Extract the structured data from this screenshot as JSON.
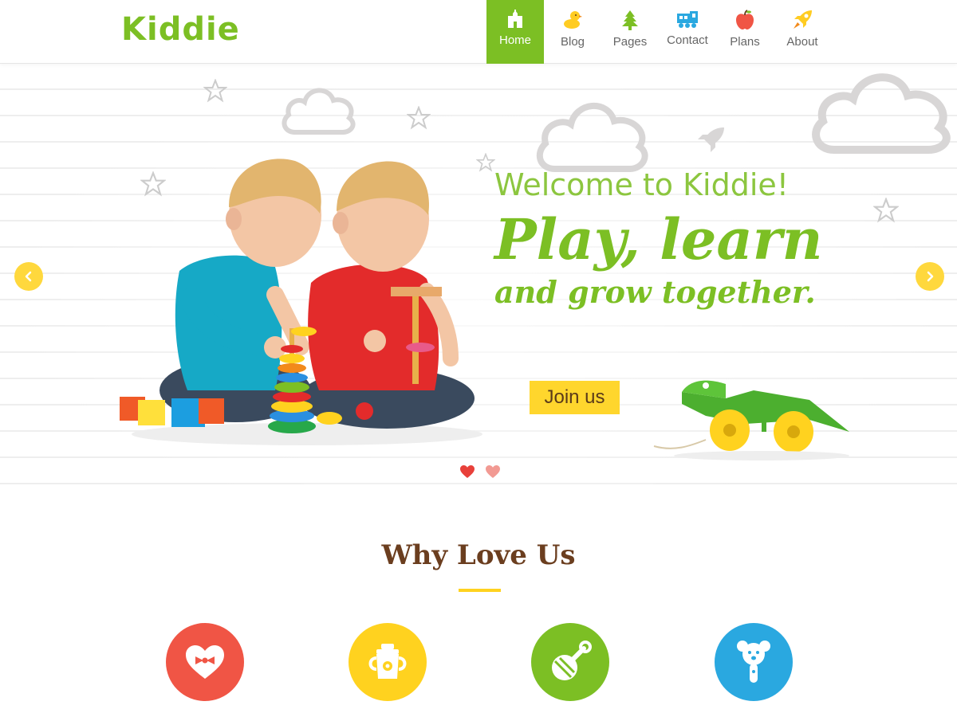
{
  "brand": {
    "name": "Kiddie",
    "color": "#7cbf24"
  },
  "nav": {
    "items": [
      {
        "label": "Home",
        "icon": "house-icon",
        "active": true
      },
      {
        "label": "Blog",
        "icon": "duck-icon",
        "active": false
      },
      {
        "label": "Pages",
        "icon": "tree-icon",
        "active": false
      },
      {
        "label": "Contact",
        "icon": "train-icon",
        "active": false
      },
      {
        "label": "Plans",
        "icon": "apple-icon",
        "active": false
      },
      {
        "label": "About",
        "icon": "rocket-icon",
        "active": false
      }
    ]
  },
  "hero": {
    "welcome": "Welcome to Kiddie!",
    "headline": "Play, learn",
    "subline": "and grow together.",
    "cta_label": "Join us",
    "image": "two-toddlers-playing-with-stacking-rings",
    "toy_image": "wooden-green-crocodile-pull-toy",
    "prev_icon": "chevron-left-icon",
    "next_icon": "chevron-right-icon",
    "slides": [
      {
        "icon": "heart-icon",
        "active": true
      },
      {
        "icon": "heart-icon",
        "active": false
      }
    ]
  },
  "why": {
    "title": "Why Love Us",
    "features": [
      {
        "icon": "heart-bow-icon",
        "color": "#f05545"
      },
      {
        "icon": "potty-icon",
        "color": "#ffd21f"
      },
      {
        "icon": "rattle-icon",
        "color": "#7cbf24"
      },
      {
        "icon": "teddy-bear-icon",
        "color": "#2aa8e0"
      }
    ]
  },
  "colors": {
    "accent_green": "#7cbf24",
    "accent_yellow": "#ffd62d",
    "accent_red": "#f05545",
    "accent_blue": "#2aa8e0",
    "heading_brown": "#6b3e1f"
  }
}
